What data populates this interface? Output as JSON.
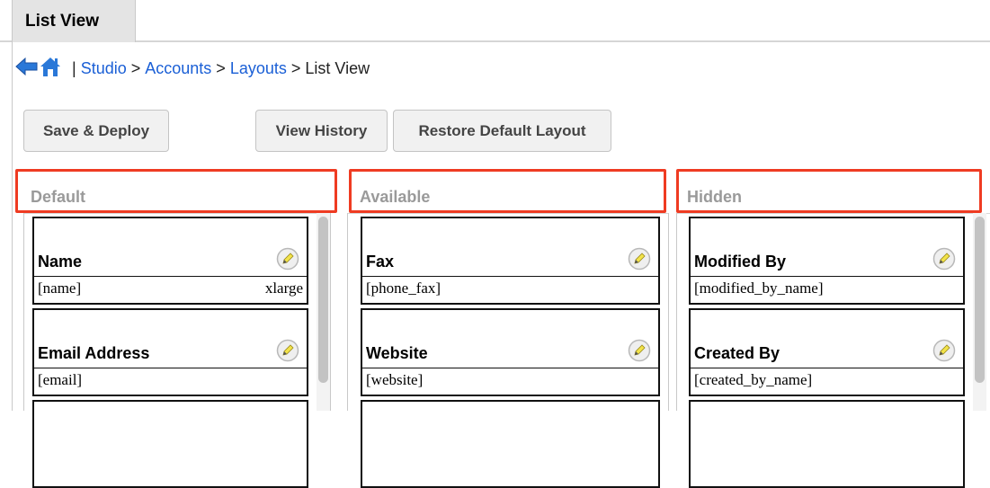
{
  "tab": {
    "label": "List View"
  },
  "breadcrumb": {
    "separator": "|",
    "arrow": ">",
    "items": [
      "Studio",
      "Accounts",
      "Layouts"
    ],
    "current": "List View"
  },
  "toolbar": {
    "save_deploy": "Save & Deploy",
    "view_history": "View History",
    "restore_default": "Restore Default Layout"
  },
  "panels": [
    {
      "title": "Default",
      "fields": [
        {
          "label": "Name",
          "field": "[name]",
          "width": "xlarge"
        },
        {
          "label": "Email Address",
          "field": "[email]",
          "width": ""
        }
      ]
    },
    {
      "title": "Available",
      "fields": [
        {
          "label": "Fax",
          "field": "[phone_fax]",
          "width": ""
        },
        {
          "label": "Website",
          "field": "[website]",
          "width": ""
        }
      ]
    },
    {
      "title": "Hidden",
      "fields": [
        {
          "label": "Modified By",
          "field": "[modified_by_name]",
          "width": ""
        },
        {
          "label": "Created By",
          "field": "[created_by_name]",
          "width": ""
        }
      ]
    }
  ],
  "colors": {
    "link": "#1a5fd6",
    "highlight": "#ef3b22",
    "back_arrow": "#2a78d8"
  },
  "icons": [
    "back-arrow-icon",
    "home-icon",
    "pencil-icon"
  ]
}
